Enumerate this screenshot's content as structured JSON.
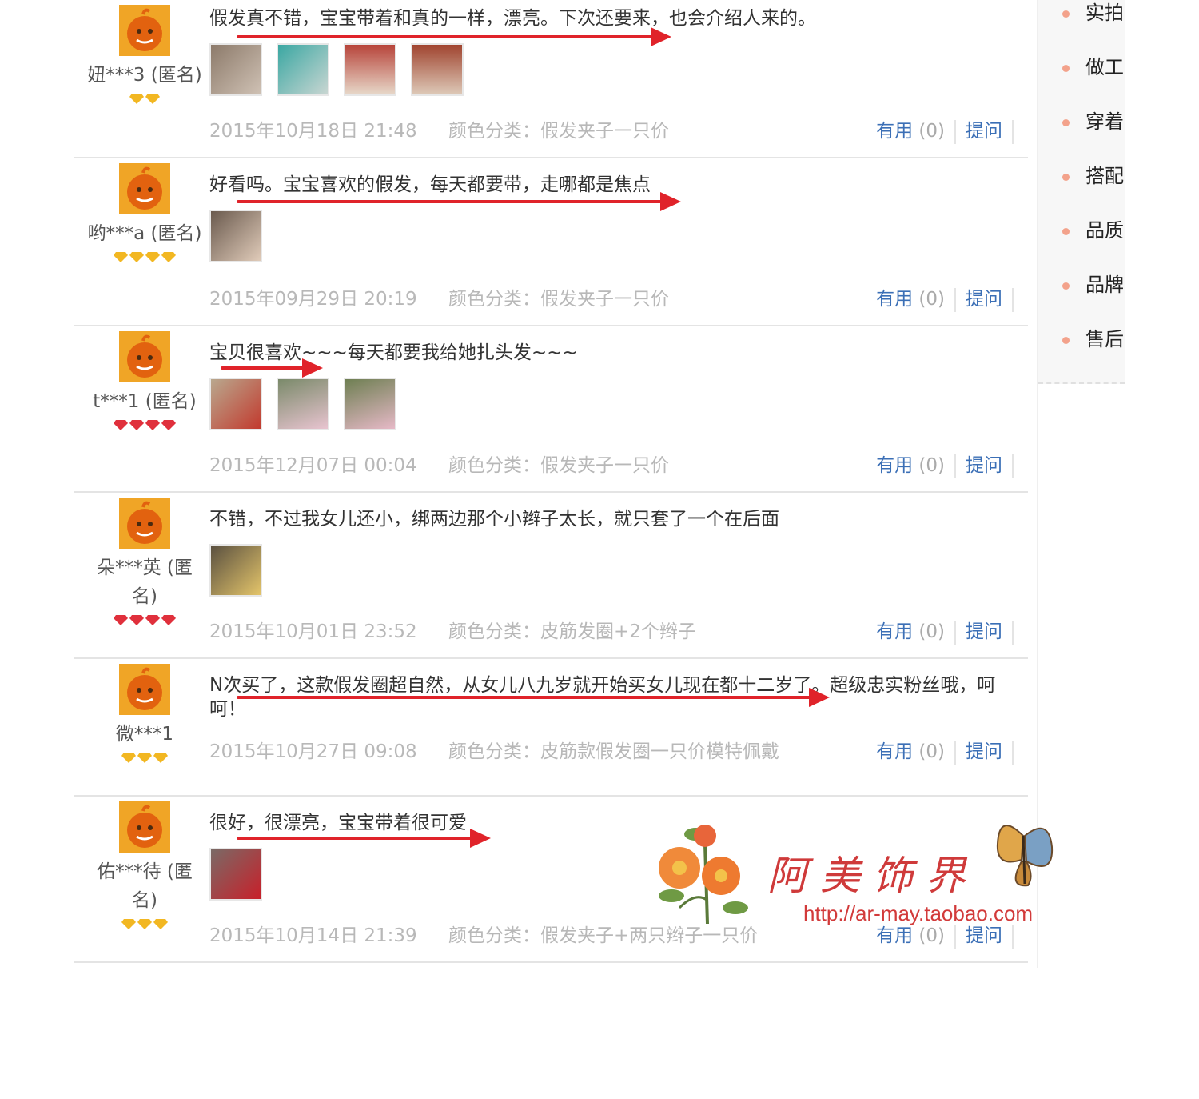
{
  "reviews": [
    {
      "user": "妞***3 (匿名)",
      "level_gems": 2,
      "gem_color": "#f2b722",
      "text": "假发真不错，宝宝带着和真的一样，漂亮。下次还要来，也会介绍人来的。",
      "photo_count": 4,
      "date": "2015年10月18日 21:48",
      "color_category": "颜色分类：假发夹子一只价",
      "useful_label": "有用",
      "useful_count": "(0)",
      "ask_label": "提问"
    },
    {
      "user": "哟***a (匿名)",
      "level_gems": 4,
      "gem_color": "#f2b722",
      "text": "好看吗。宝宝喜欢的假发，每天都要带，走哪都是焦点",
      "photo_count": 1,
      "date": "2015年09月29日 20:19",
      "color_category": "颜色分类：假发夹子一只价",
      "useful_label": "有用",
      "useful_count": "(0)",
      "ask_label": "提问"
    },
    {
      "user": "t***1 (匿名)",
      "level_gems": 4,
      "gem_color": "#e0303c",
      "text": "宝贝很喜欢~~~每天都要我给她扎头发~~~",
      "photo_count": 3,
      "date": "2015年12月07日 00:04",
      "color_category": "颜色分类：假发夹子一只价",
      "useful_label": "有用",
      "useful_count": "(0)",
      "ask_label": "提问"
    },
    {
      "user": "朵***英 (匿名)",
      "level_gems": 4,
      "gem_color": "#e0303c",
      "text": "不错，不过我女儿还小，绑两边那个小辫子太长，就只套了一个在后面",
      "photo_count": 1,
      "date": "2015年10月01日 23:52",
      "color_category": "颜色分类：皮筋发圈+2个辫子",
      "useful_label": "有用",
      "useful_count": "(0)",
      "ask_label": "提问"
    },
    {
      "user": "微***1",
      "level_gems": 3,
      "gem_color": "#f2b722",
      "text": "N次买了，这款假发圈超自然，从女儿八九岁就开始买女儿现在都十二岁了。超级忠实粉丝哦，呵呵！",
      "photo_count": 0,
      "date": "2015年10月27日 09:08",
      "color_category": "颜色分类：皮筋款假发圈一只价模特佩戴",
      "useful_label": "有用",
      "useful_count": "(0)",
      "ask_label": "提问"
    },
    {
      "user": "佑***待 (匿名)",
      "level_gems": 3,
      "gem_color": "#f2b722",
      "text": "很好，很漂亮，宝宝带着很可爱",
      "photo_count": 1,
      "date": "2015年10月14日 21:39",
      "color_category": "颜色分类：假发夹子+两只辫子一只价",
      "useful_label": "有用",
      "useful_count": "(0)",
      "ask_label": "提问"
    }
  ],
  "side_menu": [
    "实拍",
    "做工",
    "穿着",
    "搭配",
    "品质",
    "品牌",
    "售后"
  ],
  "watermark": {
    "text": "阿美饰界",
    "url": "http://ar-may.taobao.com"
  },
  "colors": {
    "link_blue": "#3b6fb6",
    "arrow_red": "#e0232a",
    "meta_gray": "#b8b8b8",
    "avatar_orange": "#f0a526"
  }
}
